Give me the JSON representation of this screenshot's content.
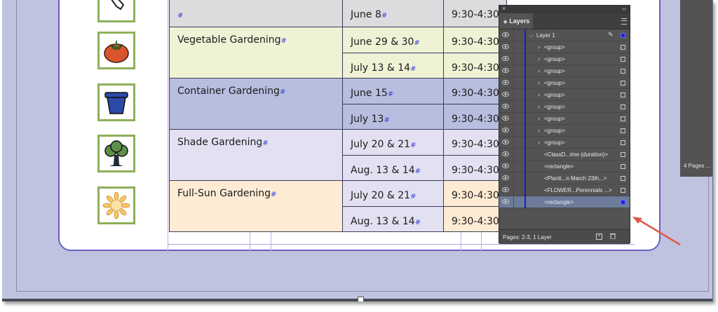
{
  "table": {
    "rows": [
      {
        "name": "",
        "dates": [
          "June 8"
        ],
        "times": [
          "9:30-4:30"
        ]
      },
      {
        "name": "Vegetable Gardening",
        "dates": [
          "June 29 & 30",
          "July 13 & 14"
        ],
        "times": [
          "9:30-4:30",
          "9:30-4:30"
        ]
      },
      {
        "name": "Container Gardening",
        "dates": [
          "June 15",
          "July 13"
        ],
        "times": [
          "9:30-4:30",
          "9:30-4:30"
        ]
      },
      {
        "name": "Shade Gardening",
        "dates": [
          "July 20 & 21",
          "Aug. 13 & 14"
        ],
        "times": [
          "9:30-4:30",
          "9:30-4:30"
        ]
      },
      {
        "name": "Full-Sun Gardening",
        "dates": [
          "July 20 & 21",
          "Aug. 13 & 14"
        ],
        "times": [
          "9:30-4:30",
          "9:30-4:30"
        ]
      }
    ],
    "marker": "#"
  },
  "icons": [
    "shovel-icon",
    "tomato-icon",
    "flower-pot-icon",
    "tree-icon",
    "sunflower-icon"
  ],
  "colors": {
    "row0": "#dcdcdf",
    "row1": "#eff2d5",
    "row2": "#b8bedf",
    "row3": "#e3e1f1",
    "row4": "#fdebd4",
    "panel": "#535353",
    "accent": "#2020d6",
    "arrow": "#e05a4a"
  },
  "layers_panel": {
    "tab_label": "Layers",
    "layer_name": "Layer 1",
    "items": [
      "<group>",
      "<group>",
      "<group>",
      "<group>",
      "<group>",
      "<group>",
      "<group>",
      "<group>",
      "<group>",
      "<ClassD...ime (duration)>",
      "<rectangle>",
      "<Planti...n March 23th...>",
      "<FLOWER...Perennials ...>",
      "<rectangle>"
    ],
    "footer": "Pages: 2-3, 1 Layer"
  },
  "pages_panel": {
    "label": "4 Pages ..."
  }
}
